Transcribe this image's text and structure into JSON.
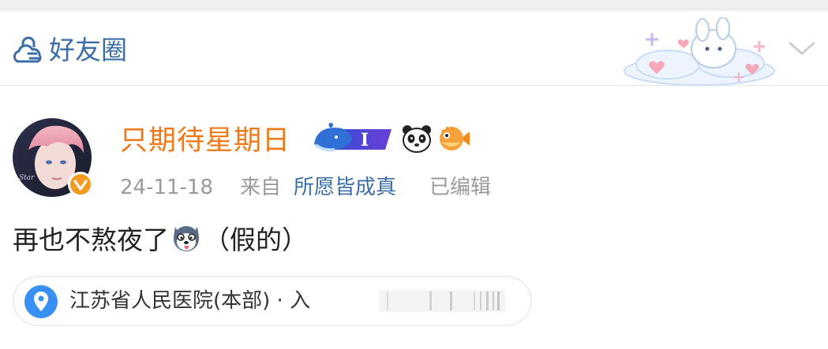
{
  "header": {
    "visibility_label": "好友圈",
    "visibility_icon": "lock-cloud-icon",
    "decoration_icon": "bunny-cloud-decoration",
    "collapse_icon": "chevron-down-icon"
  },
  "post": {
    "username": "只期待星期日",
    "username_color": "#f07a1a",
    "badges": [
      "whale-member-badge",
      "panda-icon",
      "pufferfish-icon"
    ],
    "whale_badge_text": "I",
    "verified_icon": "verified-v-icon",
    "date": "24-11-18",
    "from_label": "来自",
    "source": "所愿皆成真",
    "edited": "已编辑",
    "text_before": "再也不熬夜了",
    "emoji": "husky-tongue-emoji",
    "text_after": "（假的）"
  },
  "location": {
    "icon": "location-pin-icon",
    "text": "江苏省人民医院(本部) · 入"
  },
  "colors": {
    "link_blue": "#3b6ea8",
    "meta_gray": "#9a9a9a",
    "pin_blue": "#3a8ff5",
    "verified_orange": "#f39a1f"
  }
}
